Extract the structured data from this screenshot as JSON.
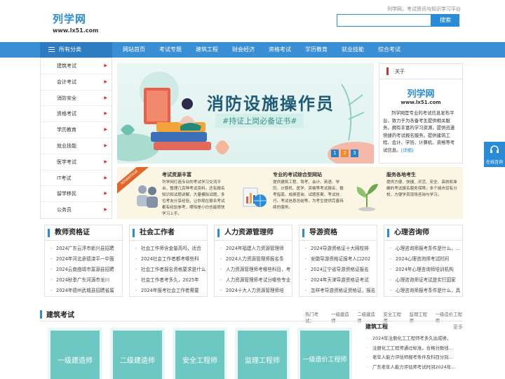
{
  "header": {
    "logo_cn": "列学网",
    "logo_en": "www.lx51.com",
    "slogan": "列学网，考试资讯与知识学习平台",
    "search_placeholder": "",
    "search_button": "搜索"
  },
  "nav": {
    "category_label": "所有分类",
    "items": [
      "网站首页",
      "考试专题",
      "建筑工程",
      "财会经济",
      "资格考试",
      "学历教育",
      "就业技能",
      "综合考试"
    ]
  },
  "left_menu": [
    "建筑考试",
    "会计考试",
    "消防安全",
    "资格考试",
    "学历教育",
    "就业技能",
    "医学考试",
    "IT考试",
    "留学移民",
    "公务员"
  ],
  "banner": {
    "title": "消防设施操作员",
    "subtitle": "#持证上岗必备证书#",
    "pages": [
      "1",
      "2",
      "3"
    ],
    "active_page": 2
  },
  "about": {
    "heading": "关于",
    "logo_cn": "列学网",
    "logo_en": "www.lx51.com",
    "description": "列学网是专业的考试信息发布平台，致力于为各备考生提供相关服务。拥有丰富的学习资源，提供迅速快捷的考试报名服务。提供建筑工程、会计、学历、计算机、资格等考试信息。",
    "more": "[详细]"
  },
  "feature": {
    "ribbon": "ADVANTAGE",
    "cols": [
      {
        "title": "考试资源丰富",
        "text": "列学网打造专业的考试学习交流平台，整理几百种考试资料，还有报名知识和试题讲解，大量模拟试题，多位考友分享经验，让你现在报名考试都有经验参考，哪怕是小白也能很快学习上手。"
      },
      {
        "title": "专业的考试综合型网站",
        "text": "提供建筑工程、驾考、会计、英语、学历、计算机、医学、资格等考试报名、报考指南、成绩查询、试题答案、考试技巧、考试信息总结等，为考生提供完善持续的服务。"
      },
      {
        "title": "服务各地考生",
        "text": "提供方便、快捷、灵活、安全、高效和准确的考试报名服务保障，多个城市设有分校，方便学员现场咨询与学习。"
      }
    ]
  },
  "categories": [
    {
      "title": "教师资格证",
      "items": [
        "2024广东云浮市新兴县招聘",
        "2024年河北承德滦平一中面",
        "2024云南曲靖市富源县招聘",
        "2024秋季广东河源市龙川",
        "2024年德州武城县招聘省属"
      ]
    },
    {
      "title": "社会工作者",
      "items": [
        "社会工作师含金量高吗，适合",
        "2024社会工作者都考哪些科",
        "社会工作者报名资格要求是什么",
        "社会工作者考多久，2025年",
        "2024年报考社会工作者需要"
      ]
    },
    {
      "title": "人力资源管理师",
      "items": [
        "2024年福建人力资源管理师",
        "2024人力资源管理师报名条",
        "人力资源管理师考哪些科目，考",
        "人力资源管理师考试分哪些专业",
        "2024十大人力资源管理师培"
      ]
    },
    {
      "title": "导游资格",
      "items": [
        "2024导游资格证十大网校排",
        "安徽导游资格证报考入口202",
        "2024辽宁省导游资格证报名",
        "2024年天津导游资格证考试",
        "怎样考导游资格证资格证，报名"
      ]
    },
    {
      "title": "心理咨询师",
      "items": [
        "心理咨询师报考条件是什么，...",
        "2024心理咨询师考试时间",
        "2024年心理咨询师培训机构",
        "心理咨询师证考试是实行国家",
        "心理咨询师报考条件是什么，具"
      ]
    }
  ],
  "section": {
    "title": "建筑考试",
    "hot_label": "热门考试：",
    "hot_links": [
      "一级建造师",
      "二级建造师",
      "安全工程师",
      "监理工程师",
      "一级造价工程师"
    ],
    "tiles": [
      "一级建造师",
      "二级建造师",
      "安全工程师",
      "监理工程师",
      "一级造价工程师"
    ],
    "side": {
      "title": "建筑工程",
      "more": "更多",
      "items": [
        "2024年注册化工工程师考多久出成绩，",
        "注册化工工程师通过标准，合格分数线...",
        "老年人能力评估师报考条件及科目分别...",
        "广东老年人能力评估师考试时间2024年..."
      ]
    }
  },
  "online_service": "在线咨询"
}
